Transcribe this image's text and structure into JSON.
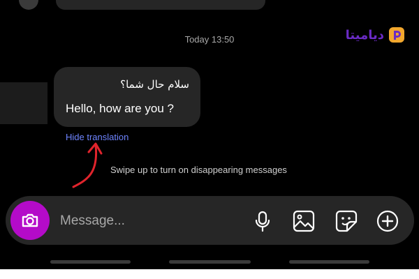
{
  "chat": {
    "timestamp": "Today 13:50",
    "message_original": "سلام حال شما؟",
    "message_translated": "Hello, how are you ?",
    "hide_translation": "Hide translation",
    "swipe_hint": "Swipe up to turn on disappearing messages"
  },
  "composer": {
    "placeholder": "Message..."
  },
  "watermark": {
    "text": "دیامیتا"
  },
  "colors": {
    "background": "#000000",
    "bubble": "#262626",
    "camera": "#b40bc9",
    "link": "#6e84ff",
    "arrow": "#e0242c",
    "watermark": "#6a2bc5"
  },
  "icons": [
    "camera-icon",
    "microphone-icon",
    "image-icon",
    "sticker-icon",
    "plus-icon",
    "logo-icon"
  ]
}
